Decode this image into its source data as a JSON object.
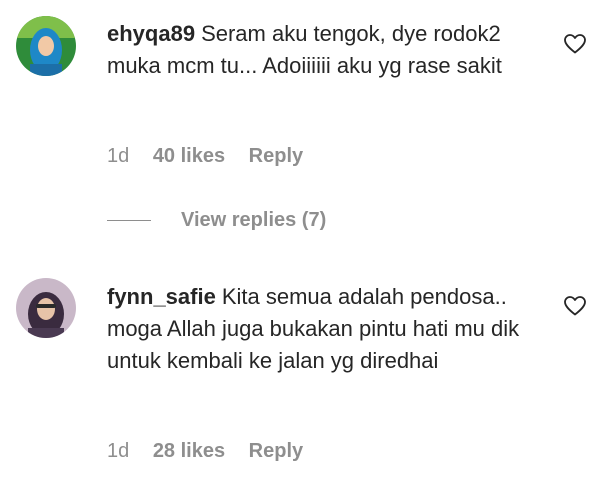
{
  "comments": [
    {
      "username": "ehyqa89",
      "text": "Seram aku tengok, dye rodok2 muka mcm tu... Adoiiiiii aku yg rase sakit",
      "time": "1d",
      "likes": "40 likes",
      "reply_label": "Reply",
      "avatar_icon": "avatar-hijab-blue-icon"
    },
    {
      "username": "fynn_safie",
      "text": "Kita semua adalah pendosa.. moga Allah juga bukakan pintu hati mu dik untuk kembali ke jalan yg diredhai",
      "time": "1d",
      "likes": "28 likes",
      "reply_label": "Reply",
      "avatar_icon": "avatar-hijab-dark-icon"
    }
  ],
  "view_replies": {
    "label": "View replies (7)"
  },
  "colors": {
    "text": "#262626",
    "muted": "#8e8e8e",
    "background": "#ffffff"
  }
}
